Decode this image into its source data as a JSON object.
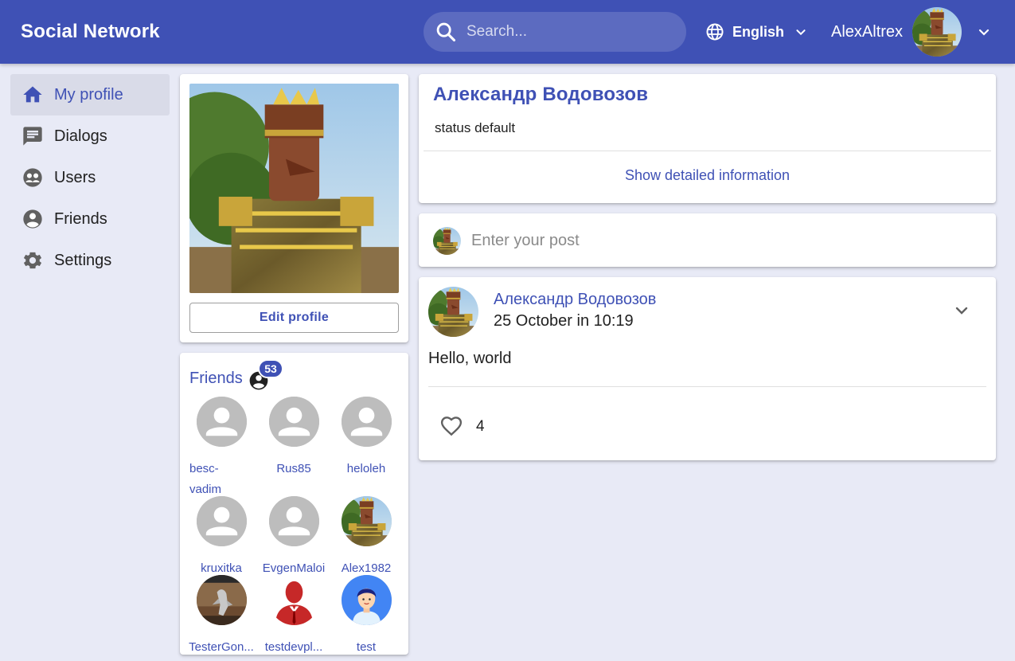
{
  "app": {
    "title": "Social Network",
    "search_placeholder": "Search...",
    "language": "English",
    "username": "AlexAltrex"
  },
  "colors": {
    "primary": "#3f51b5",
    "search_bg": "#5c6bc0",
    "page_bg": "#e8eaf6",
    "avatar_placeholder": "#bdbdbd"
  },
  "sidebar": {
    "items": [
      {
        "label": "My profile",
        "icon": "home-icon",
        "active": true
      },
      {
        "label": "Dialogs",
        "icon": "chat-icon",
        "active": false
      },
      {
        "label": "Users",
        "icon": "users-icon",
        "active": false
      },
      {
        "label": "Friends",
        "icon": "account-circle-icon",
        "active": false
      },
      {
        "label": "Settings",
        "icon": "gear-icon",
        "active": false
      }
    ]
  },
  "profile": {
    "edit_label": "Edit profile",
    "name": "Александр Водовозов",
    "status": "status default",
    "details_link": "Show detailed information"
  },
  "friends": {
    "title": "Friends",
    "count": "53",
    "list": [
      {
        "name": "besc-vadim",
        "avatar": "placeholder"
      },
      {
        "name": "Rus85",
        "avatar": "placeholder"
      },
      {
        "name": "heloleh",
        "avatar": "placeholder"
      },
      {
        "name": "kruxitka",
        "avatar": "placeholder"
      },
      {
        "name": "EvgenMaloi",
        "avatar": "placeholder"
      },
      {
        "name": "Alex1982",
        "avatar": "photo"
      },
      {
        "name": "TesterGon...",
        "avatar": "photo"
      },
      {
        "name": "testdevpl...",
        "avatar": "photo"
      },
      {
        "name": "test",
        "avatar": "photo"
      }
    ]
  },
  "new_post": {
    "placeholder": "Enter your post"
  },
  "posts": [
    {
      "author": "Александр Водовозов",
      "date": "25 October in 10:19",
      "text": "Hello, world",
      "likes": "4"
    }
  ]
}
